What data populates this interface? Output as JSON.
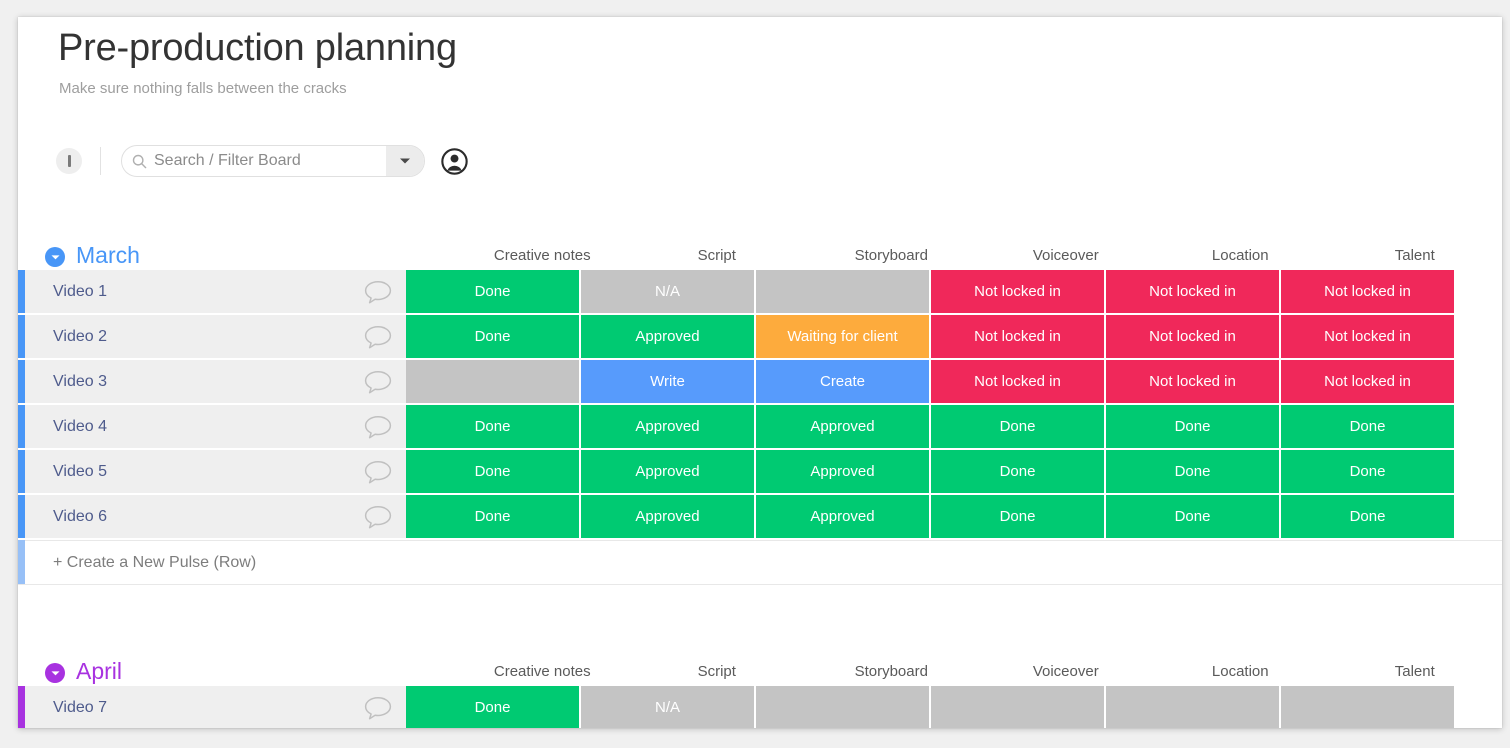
{
  "header": {
    "title": "Pre-production planning",
    "subtitle": "Make sure nothing falls between the cracks"
  },
  "toolbar": {
    "info_icon": "info-icon",
    "search": {
      "placeholder": "Search / Filter Board",
      "value": "",
      "icon": "search-icon",
      "dropdown_icon": "chevron-down-icon"
    },
    "avatar_icon": "avatar-person-icon"
  },
  "columns": [
    "Creative notes",
    "Script",
    "Storyboard",
    "Voiceover",
    "Location",
    "Talent"
  ],
  "colors": {
    "done_green": "#00ca72",
    "na_grey": "#c4c4c4",
    "not_locked_red": "#f0285a",
    "waiting_orange": "#fdab3d",
    "action_blue": "#579bfc",
    "march_blue": "#4896f7",
    "april_purple": "#a832e0",
    "add_row_blue": "#97c0f7",
    "row_name_text": "#4e5b8c"
  },
  "groups": [
    {
      "name": "March",
      "color": "#4896f7",
      "accent_class": "march",
      "toggle_icon": "chevron-down-circle-icon",
      "rows": [
        {
          "name": "Video 1",
          "comment_icon": "comment-bubble-icon",
          "cells": [
            {
              "label": "Done",
              "status": "st-green"
            },
            {
              "label": "N/A",
              "status": "st-grey"
            },
            {
              "label": "",
              "status": "st-grey"
            },
            {
              "label": "Not locked in",
              "status": "st-red"
            },
            {
              "label": "Not locked in",
              "status": "st-red"
            },
            {
              "label": "Not locked in",
              "status": "st-red"
            }
          ]
        },
        {
          "name": "Video 2",
          "comment_icon": "comment-bubble-icon",
          "cells": [
            {
              "label": "Done",
              "status": "st-green"
            },
            {
              "label": "Approved",
              "status": "st-green"
            },
            {
              "label": "Waiting for client",
              "status": "st-orange"
            },
            {
              "label": "Not locked in",
              "status": "st-red"
            },
            {
              "label": "Not locked in",
              "status": "st-red"
            },
            {
              "label": "Not locked in",
              "status": "st-red"
            }
          ]
        },
        {
          "name": "Video 3",
          "comment_icon": "comment-bubble-icon",
          "cells": [
            {
              "label": "",
              "status": "st-grey"
            },
            {
              "label": "Write",
              "status": "st-blue"
            },
            {
              "label": "Create",
              "status": "st-blue"
            },
            {
              "label": "Not locked in",
              "status": "st-red"
            },
            {
              "label": "Not locked in",
              "status": "st-red"
            },
            {
              "label": "Not locked in",
              "status": "st-red"
            }
          ]
        },
        {
          "name": "Video 4",
          "comment_icon": "comment-bubble-icon",
          "cells": [
            {
              "label": "Done",
              "status": "st-green"
            },
            {
              "label": "Approved",
              "status": "st-green"
            },
            {
              "label": "Approved",
              "status": "st-green"
            },
            {
              "label": "Done",
              "status": "st-green"
            },
            {
              "label": "Done",
              "status": "st-green"
            },
            {
              "label": "Done",
              "status": "st-green"
            }
          ]
        },
        {
          "name": "Video 5",
          "comment_icon": "comment-bubble-icon",
          "cells": [
            {
              "label": "Done",
              "status": "st-green"
            },
            {
              "label": "Approved",
              "status": "st-green"
            },
            {
              "label": "Approved",
              "status": "st-green"
            },
            {
              "label": "Done",
              "status": "st-green"
            },
            {
              "label": "Done",
              "status": "st-green"
            },
            {
              "label": "Done",
              "status": "st-green"
            }
          ]
        },
        {
          "name": "Video 6",
          "comment_icon": "comment-bubble-icon",
          "cells": [
            {
              "label": "Done",
              "status": "st-green"
            },
            {
              "label": "Approved",
              "status": "st-green"
            },
            {
              "label": "Approved",
              "status": "st-green"
            },
            {
              "label": "Done",
              "status": "st-green"
            },
            {
              "label": "Done",
              "status": "st-green"
            },
            {
              "label": "Done",
              "status": "st-green"
            }
          ]
        }
      ],
      "add_row_label": "+ Create a New Pulse (Row)"
    },
    {
      "name": "April",
      "color": "#a832e0",
      "accent_class": "april",
      "toggle_icon": "chevron-down-circle-icon",
      "rows": [
        {
          "name": "Video 7",
          "comment_icon": "comment-bubble-icon",
          "cells": [
            {
              "label": "Done",
              "status": "st-green"
            },
            {
              "label": "N/A",
              "status": "st-grey"
            },
            {
              "label": "",
              "status": "st-grey"
            },
            {
              "label": "",
              "status": "st-grey"
            },
            {
              "label": "",
              "status": "st-grey"
            },
            {
              "label": "",
              "status": "st-grey"
            }
          ]
        }
      ],
      "add_row_label": ""
    }
  ]
}
